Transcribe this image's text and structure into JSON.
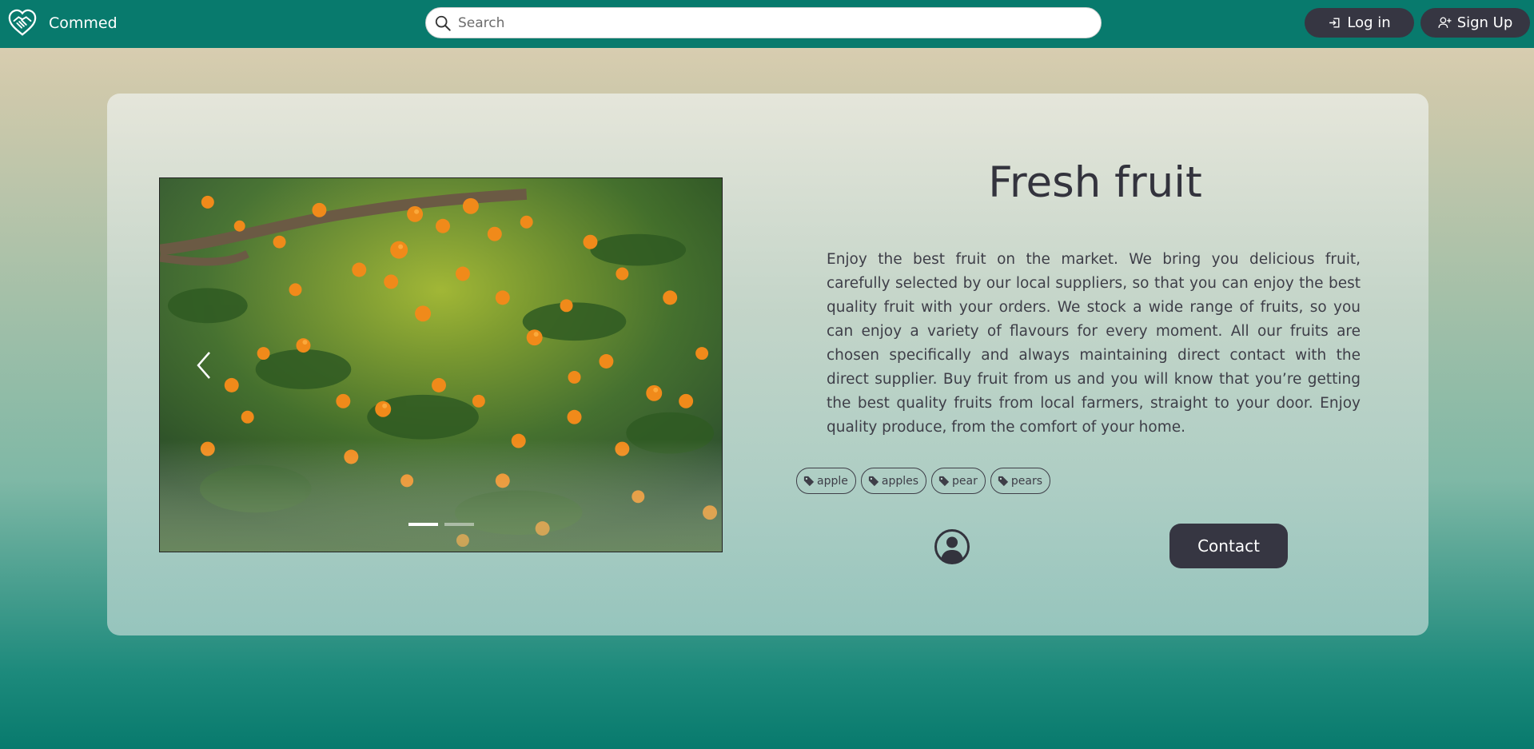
{
  "header": {
    "brand_name": "Commed",
    "search_placeholder": "Search",
    "login_label": "Log in",
    "signup_label": "Sign Up"
  },
  "product": {
    "title": "Fresh fruit",
    "description": "Enjoy the best fruit on the market. We bring you delicious fruit, carefully selected by our local suppliers, so that you can enjoy the best quality fruit with your orders. We stock a wide range of fruits, so you can enjoy a variety of flavours for every moment. All our fruits are chosen specifically and always maintaining direct contact with the direct supplier. Buy fruit from us and you will know that you’re getting the best quality fruits from local farmers, straight to your door. Enjoy quality produce, from the comfort of your home.",
    "tags": [
      "apple",
      "apples",
      "pear",
      "pears"
    ],
    "contact_label": "Contact"
  },
  "carousel": {
    "active_slide": 1,
    "slide_count": 2
  },
  "icons": {
    "logo": "handshake-heart-icon",
    "search": "search-icon",
    "login": "login-icon",
    "signup": "person-plus-icon",
    "tag": "tag-icon",
    "profile": "person-circle-icon",
    "prev": "chevron-left-icon"
  },
  "colors": {
    "navbar": "#087a6d",
    "button_dark": "#363642",
    "text_dark": "#33333d"
  }
}
